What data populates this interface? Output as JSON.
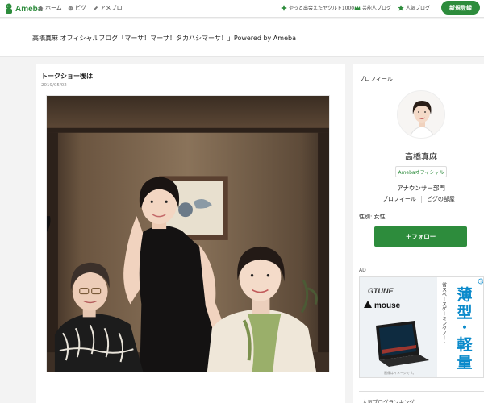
{
  "nav": {
    "logo_text": "Ameba",
    "home": "ホーム",
    "pigg": "ピグ",
    "amebro": "アメブロ",
    "yakult": "やっと出会えたヤクルト1000",
    "famous": "芸能人ブログ",
    "popular": "人気ブログ",
    "signup": "新規登録"
  },
  "blog": {
    "title": "高橋真麻 オフィシャルブログ「マーサ！マーサ！タカハシマーサ！」Powered by Ameba"
  },
  "post": {
    "title": "トークショー後は",
    "date": "2019/05/02"
  },
  "sidebar": {
    "profile_label": "プロフィール",
    "name": "高橋真麻",
    "official_badge": "Amebaオフィシャル",
    "job": "アナウンサー部門",
    "link_profile": "プロフィール",
    "link_pigg_room": "ピグの部屋",
    "gender": "性別: 女性",
    "follow_button": "＋フォロー",
    "ad_label": "AD",
    "ranking_label": "人気ブログランキング"
  },
  "ad": {
    "brand": "GTUNE",
    "maker": "mouse",
    "headline_top": "薄",
    "headline_2": "型",
    "headline_3": "・",
    "headline_4": "軽",
    "headline_5": "量",
    "subtitle": "省スペースゲーミングノート",
    "note": "画像はイメージです。",
    "brand_color": "#0a8acb"
  },
  "colors": {
    "brand_green": "#2d8c3c"
  }
}
